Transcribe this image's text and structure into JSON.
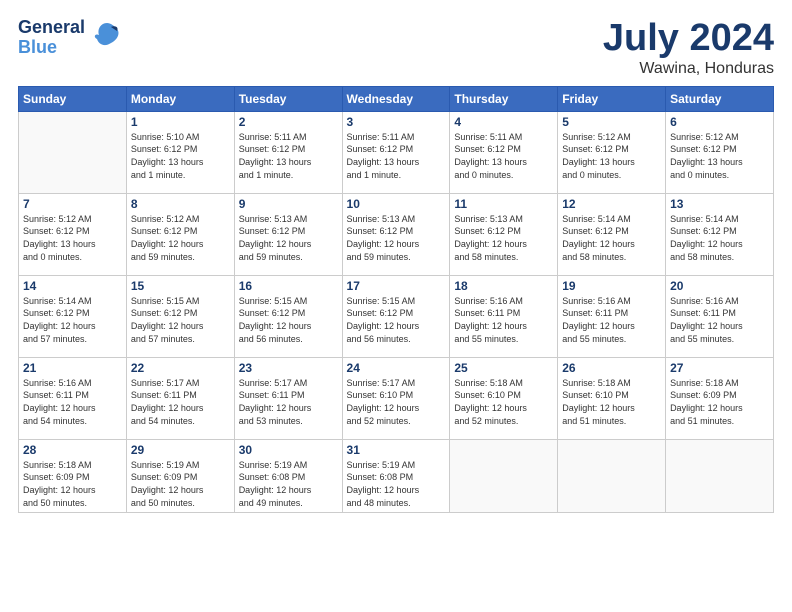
{
  "logo": {
    "line1": "General",
    "line2": "Blue"
  },
  "title": {
    "month_year": "July 2024",
    "location": "Wawina, Honduras"
  },
  "days_of_week": [
    "Sunday",
    "Monday",
    "Tuesday",
    "Wednesday",
    "Thursday",
    "Friday",
    "Saturday"
  ],
  "weeks": [
    [
      {
        "day": "",
        "info": ""
      },
      {
        "day": "1",
        "info": "Sunrise: 5:10 AM\nSunset: 6:12 PM\nDaylight: 13 hours\nand 1 minute."
      },
      {
        "day": "2",
        "info": "Sunrise: 5:11 AM\nSunset: 6:12 PM\nDaylight: 13 hours\nand 1 minute."
      },
      {
        "day": "3",
        "info": "Sunrise: 5:11 AM\nSunset: 6:12 PM\nDaylight: 13 hours\nand 1 minute."
      },
      {
        "day": "4",
        "info": "Sunrise: 5:11 AM\nSunset: 6:12 PM\nDaylight: 13 hours\nand 0 minutes."
      },
      {
        "day": "5",
        "info": "Sunrise: 5:12 AM\nSunset: 6:12 PM\nDaylight: 13 hours\nand 0 minutes."
      },
      {
        "day": "6",
        "info": "Sunrise: 5:12 AM\nSunset: 6:12 PM\nDaylight: 13 hours\nand 0 minutes."
      }
    ],
    [
      {
        "day": "7",
        "info": "Sunrise: 5:12 AM\nSunset: 6:12 PM\nDaylight: 13 hours\nand 0 minutes."
      },
      {
        "day": "8",
        "info": "Sunrise: 5:12 AM\nSunset: 6:12 PM\nDaylight: 12 hours\nand 59 minutes."
      },
      {
        "day": "9",
        "info": "Sunrise: 5:13 AM\nSunset: 6:12 PM\nDaylight: 12 hours\nand 59 minutes."
      },
      {
        "day": "10",
        "info": "Sunrise: 5:13 AM\nSunset: 6:12 PM\nDaylight: 12 hours\nand 59 minutes."
      },
      {
        "day": "11",
        "info": "Sunrise: 5:13 AM\nSunset: 6:12 PM\nDaylight: 12 hours\nand 58 minutes."
      },
      {
        "day": "12",
        "info": "Sunrise: 5:14 AM\nSunset: 6:12 PM\nDaylight: 12 hours\nand 58 minutes."
      },
      {
        "day": "13",
        "info": "Sunrise: 5:14 AM\nSunset: 6:12 PM\nDaylight: 12 hours\nand 58 minutes."
      }
    ],
    [
      {
        "day": "14",
        "info": "Sunrise: 5:14 AM\nSunset: 6:12 PM\nDaylight: 12 hours\nand 57 minutes."
      },
      {
        "day": "15",
        "info": "Sunrise: 5:15 AM\nSunset: 6:12 PM\nDaylight: 12 hours\nand 57 minutes."
      },
      {
        "day": "16",
        "info": "Sunrise: 5:15 AM\nSunset: 6:12 PM\nDaylight: 12 hours\nand 56 minutes."
      },
      {
        "day": "17",
        "info": "Sunrise: 5:15 AM\nSunset: 6:12 PM\nDaylight: 12 hours\nand 56 minutes."
      },
      {
        "day": "18",
        "info": "Sunrise: 5:16 AM\nSunset: 6:11 PM\nDaylight: 12 hours\nand 55 minutes."
      },
      {
        "day": "19",
        "info": "Sunrise: 5:16 AM\nSunset: 6:11 PM\nDaylight: 12 hours\nand 55 minutes."
      },
      {
        "day": "20",
        "info": "Sunrise: 5:16 AM\nSunset: 6:11 PM\nDaylight: 12 hours\nand 55 minutes."
      }
    ],
    [
      {
        "day": "21",
        "info": "Sunrise: 5:16 AM\nSunset: 6:11 PM\nDaylight: 12 hours\nand 54 minutes."
      },
      {
        "day": "22",
        "info": "Sunrise: 5:17 AM\nSunset: 6:11 PM\nDaylight: 12 hours\nand 54 minutes."
      },
      {
        "day": "23",
        "info": "Sunrise: 5:17 AM\nSunset: 6:11 PM\nDaylight: 12 hours\nand 53 minutes."
      },
      {
        "day": "24",
        "info": "Sunrise: 5:17 AM\nSunset: 6:10 PM\nDaylight: 12 hours\nand 52 minutes."
      },
      {
        "day": "25",
        "info": "Sunrise: 5:18 AM\nSunset: 6:10 PM\nDaylight: 12 hours\nand 52 minutes."
      },
      {
        "day": "26",
        "info": "Sunrise: 5:18 AM\nSunset: 6:10 PM\nDaylight: 12 hours\nand 51 minutes."
      },
      {
        "day": "27",
        "info": "Sunrise: 5:18 AM\nSunset: 6:09 PM\nDaylight: 12 hours\nand 51 minutes."
      }
    ],
    [
      {
        "day": "28",
        "info": "Sunrise: 5:18 AM\nSunset: 6:09 PM\nDaylight: 12 hours\nand 50 minutes."
      },
      {
        "day": "29",
        "info": "Sunrise: 5:19 AM\nSunset: 6:09 PM\nDaylight: 12 hours\nand 50 minutes."
      },
      {
        "day": "30",
        "info": "Sunrise: 5:19 AM\nSunset: 6:08 PM\nDaylight: 12 hours\nand 49 minutes."
      },
      {
        "day": "31",
        "info": "Sunrise: 5:19 AM\nSunset: 6:08 PM\nDaylight: 12 hours\nand 48 minutes."
      },
      {
        "day": "",
        "info": ""
      },
      {
        "day": "",
        "info": ""
      },
      {
        "day": "",
        "info": ""
      }
    ]
  ]
}
